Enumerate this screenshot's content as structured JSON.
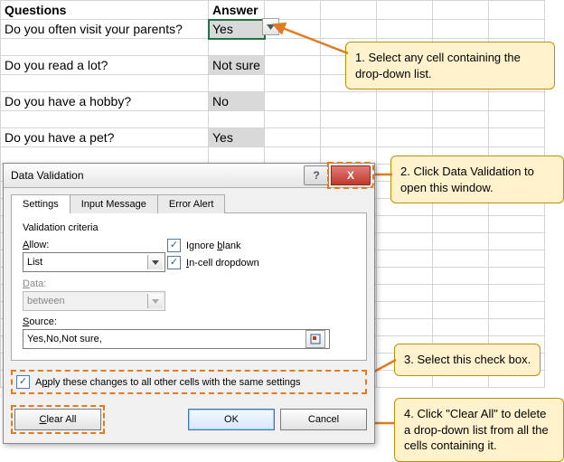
{
  "sheet": {
    "headers": {
      "q": "Questions",
      "a": "Answer"
    },
    "rows": [
      {
        "q": "Do you often visit your parents?",
        "a": "Yes"
      },
      {
        "q": "Do you read a lot?",
        "a": "Not sure"
      },
      {
        "q": "Do you have a hobby?",
        "a": "No"
      },
      {
        "q": "Do you have a pet?",
        "a": "Yes"
      }
    ]
  },
  "callouts": {
    "c1": "1. Select any cell containing the drop-down list.",
    "c2": "2. Click Data Validation to open this window.",
    "c3": "3. Select this check box.",
    "c4": "4. Click \"Clear All\" to delete a drop-down list from all the cells containing it."
  },
  "dialog": {
    "title": "Data Validation",
    "help": "?",
    "close": "X",
    "tabs": {
      "settings": "Settings",
      "input_message": "Input Message",
      "error_alert": "Error Alert"
    },
    "criteria_label": "Validation criteria",
    "allow_label": "Allow:",
    "allow_value": "List",
    "ignore_blank": "Ignore blank",
    "incell_dropdown": "In-cell dropdown",
    "data_label": "Data:",
    "data_value": "between",
    "source_label": "Source:",
    "source_value": "Yes,No,Not sure,",
    "apply_label": "Apply these changes to all other cells with the same settings",
    "buttons": {
      "clear_all": "Clear All",
      "ok": "OK",
      "cancel": "Cancel"
    }
  }
}
